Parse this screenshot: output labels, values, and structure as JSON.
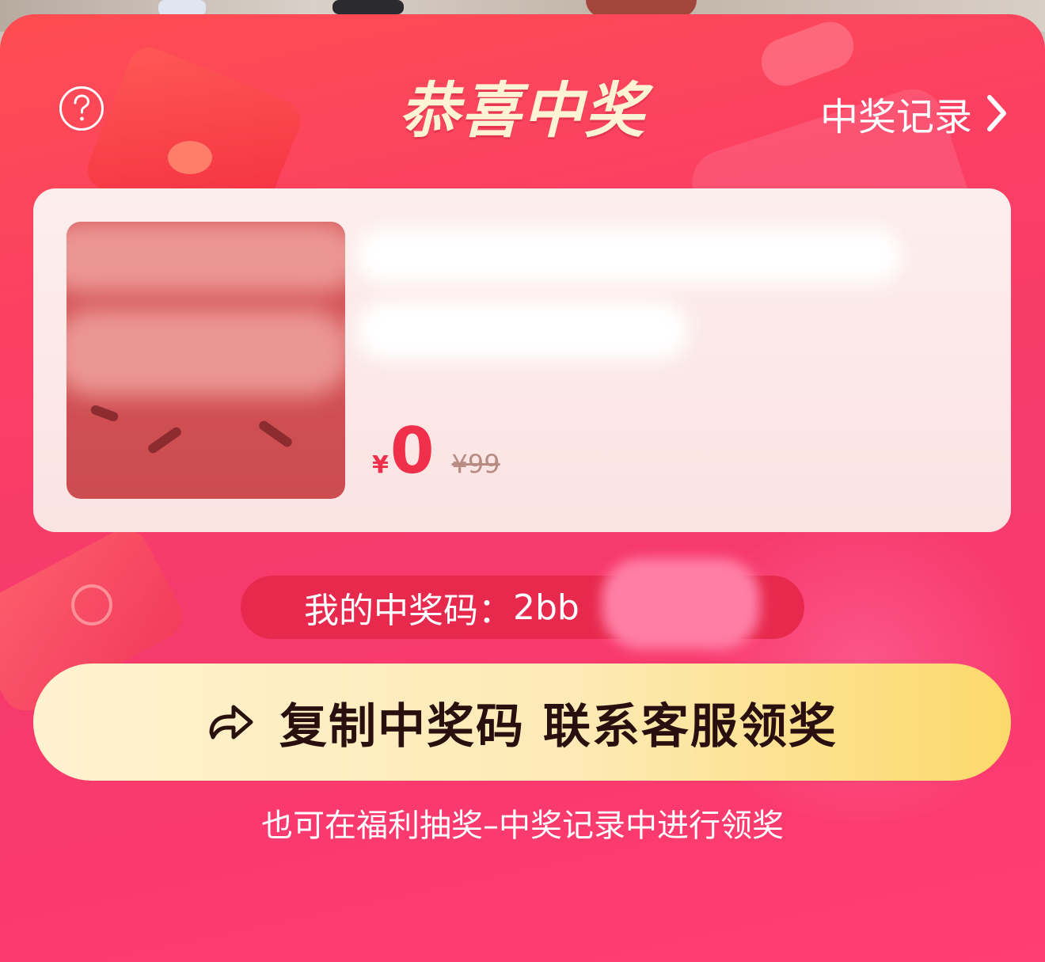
{
  "header": {
    "title": "恭喜中奖",
    "records_label": "中奖记录"
  },
  "prize": {
    "currency": "¥",
    "price": "0",
    "original_price": "¥99"
  },
  "code": {
    "label": "我的中奖码：",
    "value": "2bb"
  },
  "cta": {
    "label": "复制中奖码 联系客服领奖"
  },
  "hint": "也可在福利抽奖–中奖记录中进行领奖",
  "icons": [
    "help-icon",
    "chevron-right-icon",
    "share-icon"
  ],
  "colors": {
    "panel_red": "#f63a6c",
    "title_cream": "#fff3d6",
    "price_red": "#f0304a",
    "cta_gold": "#fcd96b",
    "code_pill": "#e8294e"
  }
}
